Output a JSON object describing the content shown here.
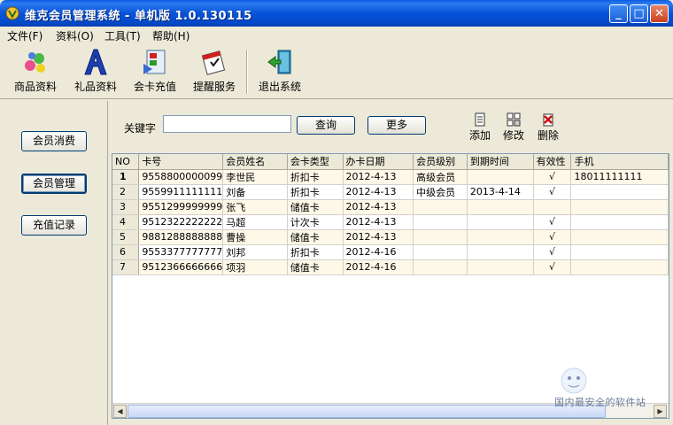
{
  "window": {
    "title": "维克会员管理系统 - 单机版 1.0.130115",
    "min": "_",
    "max": "□",
    "close": "✕"
  },
  "menu": [
    "文件(F)",
    "资料(O)",
    "工具(T)",
    "帮助(H)"
  ],
  "toolbar": [
    {
      "label": "商品资料",
      "icon": "product-icon"
    },
    {
      "label": "礼品资料",
      "icon": "gift-icon"
    },
    {
      "label": "会卡充值",
      "icon": "recharge-icon"
    },
    {
      "label": "提醒服务",
      "icon": "reminder-icon"
    },
    {
      "label": "退出系统",
      "icon": "exit-icon"
    }
  ],
  "sidebar": [
    "会员消费",
    "会员管理",
    "充值记录"
  ],
  "search": {
    "label": "关键字",
    "value": "",
    "query_label": "查询",
    "more_label": "更多"
  },
  "actions": [
    {
      "label": "添加",
      "icon": "add-icon"
    },
    {
      "label": "修改",
      "icon": "edit-icon"
    },
    {
      "label": "删除",
      "icon": "delete-icon"
    }
  ],
  "table": {
    "columns": [
      "NO",
      "卡号",
      "会员姓名",
      "会卡类型",
      "办卡日期",
      "会员级别",
      "到期时间",
      "有效性",
      "手机"
    ],
    "rows": [
      [
        "1",
        "9558800000099",
        "李世民",
        "折扣卡",
        "2012-4-13",
        "高级会员",
        "",
        "√",
        "18011111111"
      ],
      [
        "2",
        "9559911111111",
        "刘备",
        "折扣卡",
        "2012-4-13",
        "中级会员",
        "2013-4-14",
        "√",
        ""
      ],
      [
        "3",
        "9551299999999",
        "张飞",
        "储值卡",
        "2012-4-13",
        "",
        "",
        "",
        ""
      ],
      [
        "4",
        "9512322222222",
        "马超",
        "计次卡",
        "2012-4-13",
        "",
        "",
        "√",
        ""
      ],
      [
        "5",
        "9881288888888",
        "曹操",
        "储值卡",
        "2012-4-13",
        "",
        "",
        "√",
        ""
      ],
      [
        "6",
        "9553377777777",
        "刘邦",
        "折扣卡",
        "2012-4-16",
        "",
        "",
        "√",
        ""
      ],
      [
        "7",
        "9512366666666",
        "项羽",
        "储值卡",
        "2012-4-16",
        "",
        "",
        "√",
        ""
      ]
    ]
  },
  "watermark": {
    "text": "国内最安全的软件站"
  }
}
